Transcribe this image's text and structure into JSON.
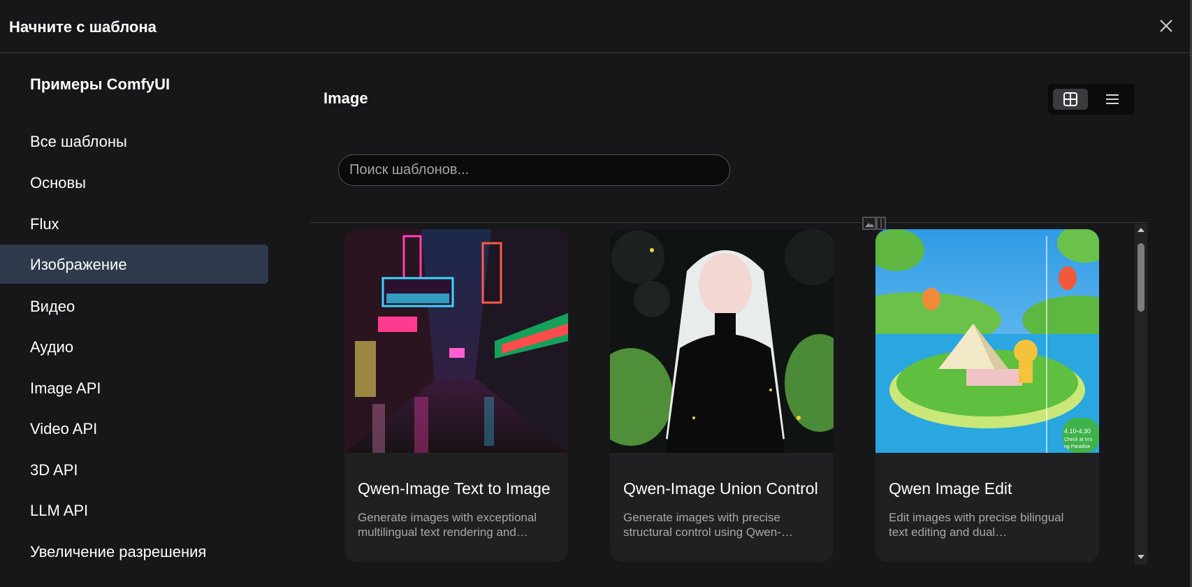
{
  "dialog": {
    "title": "Начните с шаблона",
    "close_icon": "close-icon"
  },
  "sidebar": {
    "heading": "Примеры ComfyUI",
    "items": [
      {
        "label": "Все шаблоны",
        "active": false
      },
      {
        "label": "Основы",
        "active": false
      },
      {
        "label": "Flux",
        "active": false
      },
      {
        "label": "Изображение",
        "active": true
      },
      {
        "label": "Видео",
        "active": false
      },
      {
        "label": "Аудио",
        "active": false
      },
      {
        "label": "Image API",
        "active": false
      },
      {
        "label": "Video API",
        "active": false
      },
      {
        "label": "3D API",
        "active": false
      },
      {
        "label": "LLM API",
        "active": false
      },
      {
        "label": "Увеличение разрешения",
        "active": false
      }
    ]
  },
  "main": {
    "section_title": "Image",
    "view_modes": [
      {
        "icon": "grid-view-icon",
        "selected": true
      },
      {
        "icon": "list-view-icon",
        "selected": false
      }
    ],
    "search": {
      "placeholder": "Поиск шаблонов...",
      "value": ""
    },
    "cards": [
      {
        "title": "Qwen-Image Text to Image",
        "description_line1": "Generate images with exceptional",
        "description_line2": "multilingual text rendering and…",
        "thumb_icon": "neon-street-thumbnail"
      },
      {
        "title": "Qwen-Image Union Control",
        "description_line1": "Generate images with precise",
        "description_line2": "structural control using Qwen-…",
        "thumb_icon": "elf-portrait-thumbnail"
      },
      {
        "title": "Qwen Image Edit",
        "description_line1": "Edit images with precise bilingual",
        "description_line2": "text editing and dual…",
        "thumb_icon": "island-camp-thumbnail",
        "thumb_overlay_lines": [
          "4.10-4.30",
          "Check at In's",
          "ng Paradise"
        ]
      }
    ]
  },
  "colors": {
    "background": "#171719",
    "active_nav": "#2e3a4c",
    "card": "#202022",
    "muted_text": "#a8a8ac"
  }
}
